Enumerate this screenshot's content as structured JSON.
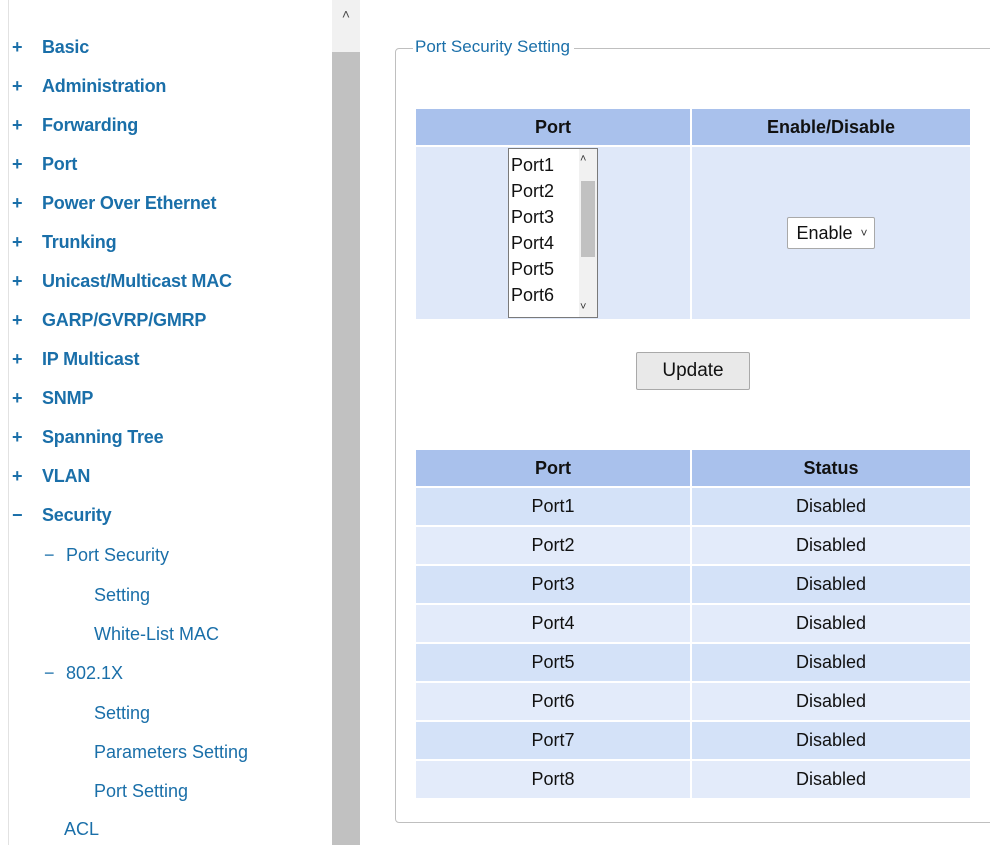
{
  "nav": {
    "items": [
      {
        "sign": "+",
        "label": "Basic"
      },
      {
        "sign": "+",
        "label": "Administration"
      },
      {
        "sign": "+",
        "label": "Forwarding"
      },
      {
        "sign": "+",
        "label": "Port"
      },
      {
        "sign": "+",
        "label": "Power Over Ethernet"
      },
      {
        "sign": "+",
        "label": "Trunking"
      },
      {
        "sign": "+",
        "label": "Unicast/Multicast MAC"
      },
      {
        "sign": "+",
        "label": "GARP/GVRP/GMRP"
      },
      {
        "sign": "+",
        "label": "IP Multicast"
      },
      {
        "sign": "+",
        "label": "SNMP"
      },
      {
        "sign": "+",
        "label": "Spanning Tree"
      },
      {
        "sign": "+",
        "label": "VLAN"
      },
      {
        "sign": "−",
        "label": "Security"
      }
    ],
    "security_children": {
      "port_security": {
        "sign": "−",
        "label": "Port Security"
      },
      "port_security_setting": "Setting",
      "white_list_mac": "White-List MAC",
      "dot1x": {
        "sign": "−",
        "label": "802.1X"
      },
      "dot1x_setting": "Setting",
      "dot1x_parameters": "Parameters Setting",
      "dot1x_port_setting": "Port Setting",
      "acl": "ACL"
    },
    "scroll_up_icon": "chevron-up-icon"
  },
  "panel": {
    "legend": "Port Security Setting",
    "setting_table": {
      "headers": {
        "port": "Port",
        "enable": "Enable/Disable"
      },
      "port_options": [
        "Port1",
        "Port2",
        "Port3",
        "Port4",
        "Port5",
        "Port6"
      ],
      "enable_value": "Enable"
    },
    "update_label": "Update",
    "status_table": {
      "headers": {
        "port": "Port",
        "status": "Status"
      },
      "rows": [
        {
          "port": "Port1",
          "status": "Disabled"
        },
        {
          "port": "Port2",
          "status": "Disabled"
        },
        {
          "port": "Port3",
          "status": "Disabled"
        },
        {
          "port": "Port4",
          "status": "Disabled"
        },
        {
          "port": "Port5",
          "status": "Disabled"
        },
        {
          "port": "Port6",
          "status": "Disabled"
        },
        {
          "port": "Port7",
          "status": "Disabled"
        },
        {
          "port": "Port8",
          "status": "Disabled"
        }
      ]
    }
  },
  "colors": {
    "link": "#1a6fa9",
    "header_bg": "#a9c1ec",
    "row_bg": "#d4e2f8",
    "row_alt_bg": "#e3ebfa"
  }
}
